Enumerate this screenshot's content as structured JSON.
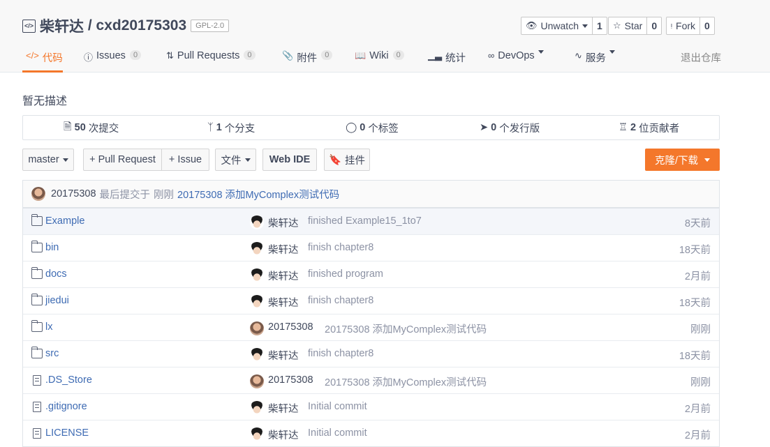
{
  "repo": {
    "owner": "柴轩达",
    "sep": " / ",
    "name": "cxd20175303",
    "license": "GPL-2.0"
  },
  "actions": [
    {
      "label": "Unwatch",
      "count": "1",
      "icon": "eye-icon"
    },
    {
      "label": "Star",
      "count": "0",
      "icon": "star-icon"
    },
    {
      "label": "Fork",
      "count": "0",
      "icon": "fork-icon"
    }
  ],
  "tabs": [
    {
      "label": "代码",
      "icon": "code-icon",
      "active": true
    },
    {
      "label": "Issues",
      "count": "0",
      "icon": "issue-icon"
    },
    {
      "label": "Pull Requests",
      "count": "0",
      "icon": "pull-request-icon"
    },
    {
      "label": "附件",
      "count": "0",
      "icon": "paperclip-icon"
    },
    {
      "label": "Wiki",
      "count": "0",
      "icon": "book-icon"
    },
    {
      "label": "统计",
      "icon": "bar-chart-icon"
    },
    {
      "label": "DevOps",
      "icon": "infinity-icon"
    },
    {
      "label": "服务",
      "icon": "pulse-icon"
    },
    {
      "label": "退出仓库"
    }
  ],
  "description": "暂无描述",
  "stats": [
    {
      "value": "50",
      "label": "次提交",
      "icon": "commit-icon"
    },
    {
      "value": "1",
      "label": "个分支",
      "icon": "branch-icon"
    },
    {
      "value": "0",
      "label": "个标签",
      "icon": "tag-icon"
    },
    {
      "value": "0",
      "label": "个发行版",
      "icon": "release-icon"
    },
    {
      "value": "2",
      "label": "位贡献者",
      "icon": "contributors-icon"
    }
  ],
  "toolbar": {
    "branch": "master",
    "pull_request": "+ Pull Request",
    "issue": "+ Issue",
    "files": "文件",
    "web_ide": "Web IDE",
    "widget": "挂件",
    "clone": "克隆/下载"
  },
  "last_commit": {
    "author": "20175308",
    "text": "最后提交于",
    "time": "刚刚",
    "message": "20175308 添加MyComplex测试代码"
  },
  "files": [
    {
      "type": "folder",
      "name": "Example",
      "author": "柴轩达",
      "avatar": "cartoon",
      "message": "finished Example15_1to7",
      "time": "8天前"
    },
    {
      "type": "folder",
      "name": "bin",
      "author": "柴轩达",
      "avatar": "cartoon",
      "message": "finish chapter8",
      "time": "18天前"
    },
    {
      "type": "folder",
      "name": "docs",
      "author": "柴轩达",
      "avatar": "cartoon",
      "message": "finished program",
      "time": "2月前"
    },
    {
      "type": "folder",
      "name": "jiedui",
      "author": "柴轩达",
      "avatar": "cartoon",
      "message": "finish chapter8",
      "time": "18天前"
    },
    {
      "type": "folder",
      "name": "lx",
      "author": "20175308",
      "avatar": "photo",
      "message": "20175308 添加MyComplex测试代码",
      "time": "刚刚"
    },
    {
      "type": "folder",
      "name": "src",
      "author": "柴轩达",
      "avatar": "cartoon",
      "message": "finish chapter8",
      "time": "18天前"
    },
    {
      "type": "file",
      "name": ".DS_Store",
      "author": "20175308",
      "avatar": "photo",
      "message": "20175308 添加MyComplex测试代码",
      "time": "刚刚"
    },
    {
      "type": "file",
      "name": ".gitignore",
      "author": "柴轩达",
      "avatar": "cartoon",
      "message": "Initial commit",
      "time": "2月前"
    },
    {
      "type": "file",
      "name": "LICENSE",
      "author": "柴轩达",
      "avatar": "cartoon",
      "message": "Initial commit",
      "time": "2月前"
    }
  ],
  "colors": {
    "accent": "#f4772b",
    "link": "#3e6bb3",
    "text": "#40485b",
    "muted": "#8c92a4"
  }
}
